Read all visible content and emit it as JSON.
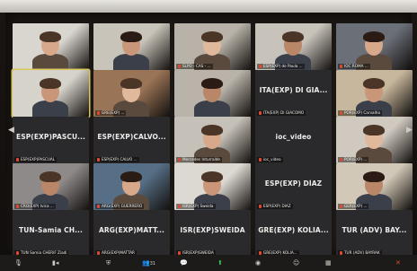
{
  "tiles": [
    {
      "name": "",
      "center": "",
      "bg": "#d9d5cf"
    },
    {
      "name": "",
      "center": "",
      "bg": "#c9c4ba"
    },
    {
      "name": "SLPO - CAS - ...",
      "center": "",
      "bg": "#b8b2a8"
    },
    {
      "name": "ESP(EXP) de Paula ...",
      "center": "",
      "bg": "#c7c2ba"
    },
    {
      "name": "IOC ROMA ...",
      "center": "",
      "bg": "#6b6f78"
    },
    {
      "name": "",
      "center": "",
      "bg": "#d6d3cb"
    },
    {
      "name": "GRE(EXP) ...",
      "center": "",
      "bg": "#9a7456"
    },
    {
      "name": "",
      "center": "",
      "bg": "#b9b3a9"
    },
    {
      "name": "ITA(EXP) DI GIACOMO",
      "center": "ITA(EXP) DI GIA...",
      "bg": "#2a2a2c"
    },
    {
      "name": "POR(EXP) Carvalho",
      "center": "",
      "bg": "#c7b79c"
    },
    {
      "name": "ESP(EXP)PASCUAL",
      "center": "ESP(EXP)PASCU...",
      "bg": "#2a2a2c"
    },
    {
      "name": "ESP(EXP) CALVO ...",
      "center": "ESP(EXP)CALVO...",
      "bg": "#2a2a2c"
    },
    {
      "name": "Mercedes Inturralde",
      "center": "",
      "bg": "#c6c1b8"
    },
    {
      "name": "ioc_video",
      "center": "ioc_video",
      "bg": "#2a2a2c"
    },
    {
      "name": "POR(EXP) ...",
      "center": "",
      "bg": "#cfc9c0"
    },
    {
      "name": "CRO(EXP) Ivica ...",
      "center": "",
      "bg": "#8f8a8a"
    },
    {
      "name": "ARG(EXP) GUERRERO",
      "center": "",
      "bg": "#566f86"
    },
    {
      "name": "ISR(EXP) Sweida",
      "center": "",
      "bg": "#dcd9d2"
    },
    {
      "name": "ESP(EXP) DIAZ",
      "center": "ESP(EXP) DÍAZ",
      "bg": "#2a2a2c"
    },
    {
      "name": "GER(EXP) ...",
      "center": "",
      "bg": "#d2c8b7"
    },
    {
      "name": "TUN Samia CHERIF Ziadi",
      "center": "TUN-Samia CH...",
      "bg": "#2a2a2c"
    },
    {
      "name": "ARG(EXP)MATTAR",
      "center": "ARG(EXP)MATT...",
      "bg": "#2a2a2c"
    },
    {
      "name": "ISR(EXP)SWEIDA",
      "center": "ISR(EXP)SWEIDA",
      "bg": "#2a2a2c"
    },
    {
      "name": "GRE(EXP) KOLIA...",
      "center": "GRE(EXP) KOLIA...",
      "bg": "#2a2a2c"
    },
    {
      "name": "TUR (ADV) BAYRAK",
      "center": "TUR (ADV) BAY...",
      "bg": "#2a2a2c"
    }
  ],
  "toolbar": {
    "icons": [
      "mic-icon",
      "video-icon",
      "shield-icon",
      "participants-icon",
      "chat-icon",
      "share-icon",
      "record-icon",
      "reactions-icon",
      "apps-icon",
      "leave-icon"
    ],
    "participants_count": "31"
  }
}
